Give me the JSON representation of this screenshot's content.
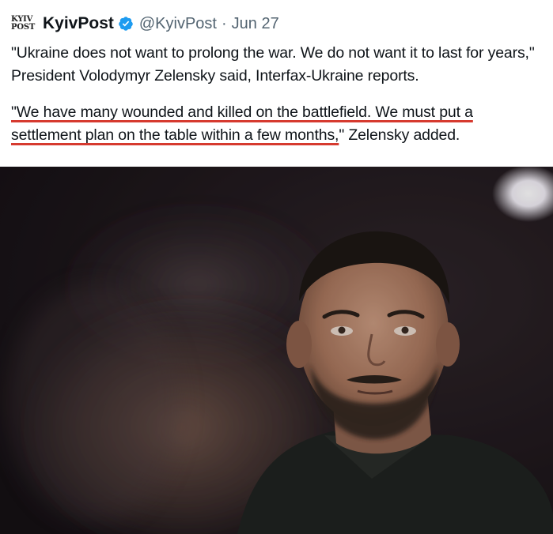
{
  "tweet": {
    "logo_line1": "KYIV",
    "logo_line2": "POST",
    "author_name": "KyivPost",
    "handle": "@KyivPost",
    "separator": "·",
    "date": "Jun 27",
    "paragraph1": "\"Ukraine does not want to prolong the war. We do not want it to last for years,\" President Volodymyr Zelensky said, Interfax-Ukraine reports.",
    "paragraph2_highlight": "\"We have many wounded and killed on the battlefield. We must put a settlement plan on the table within a few months,",
    "paragraph2_rest": "\" Zelensky added."
  },
  "icons": {
    "verified": "verified-badge-icon"
  },
  "colors": {
    "verified_blue": "#1d9bf0",
    "underline_red": "#d63a2f",
    "meta_gray": "#536471",
    "text": "#0f1419"
  }
}
